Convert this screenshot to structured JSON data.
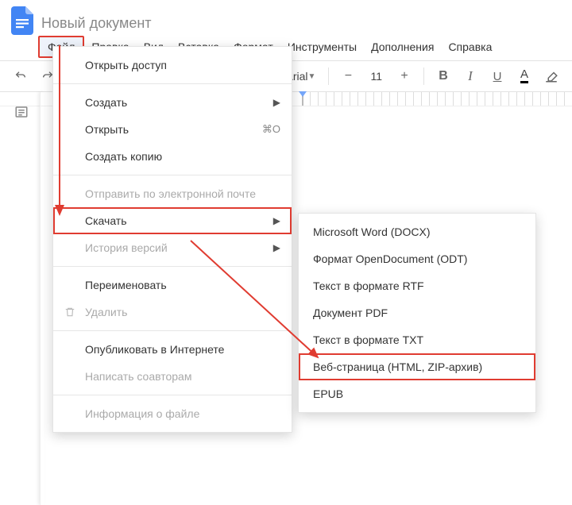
{
  "doc_title": "Новый документ",
  "menubar": {
    "file": "Файл",
    "edit": "Правка",
    "view": "Вид",
    "insert": "Вставка",
    "format": "Формат",
    "tools": "Инструменты",
    "addons": "Дополнения",
    "help": "Справка"
  },
  "toolbar": {
    "font": "Arial",
    "font_size": "11",
    "bold": "B",
    "italic": "I",
    "underline": "U",
    "textcolor": "A"
  },
  "file_menu": {
    "share": "Открыть доступ",
    "new": "Создать",
    "open": "Открыть",
    "open_shortcut": "⌘O",
    "make_copy": "Создать копию",
    "email": "Отправить по электронной почте",
    "download": "Скачать",
    "version_history": "История версий",
    "rename": "Переименовать",
    "delete": "Удалить",
    "publish": "Опубликовать в Интернете",
    "write_coauthors": "Написать соавторам",
    "file_info": "Информация о файле"
  },
  "download_submenu": {
    "docx": "Microsoft Word (DOCX)",
    "odt": "Формат OpenDocument (ODT)",
    "rtf": "Текст в формате RTF",
    "pdf": "Документ PDF",
    "txt": "Текст в формате TXT",
    "html_zip": "Веб-страница (HTML, ZIP-архив)",
    "epub": "EPUB"
  }
}
